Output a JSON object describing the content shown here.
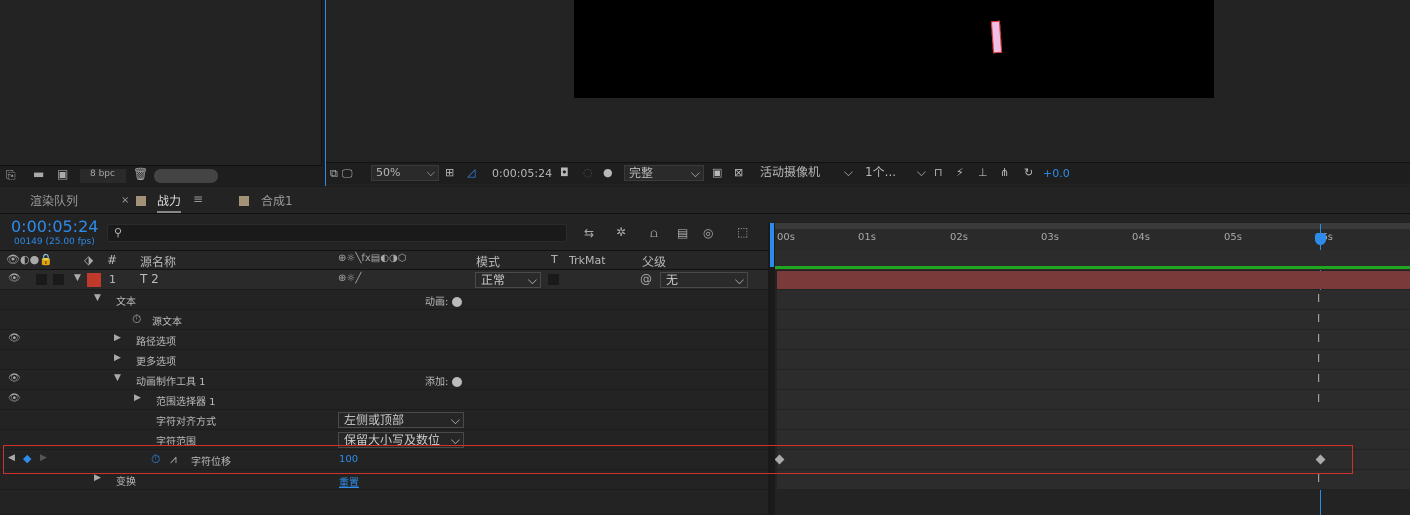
{
  "project": {
    "bpc": "8 bpc"
  },
  "comp_viewer": {
    "zoom": "50%",
    "timecode": "0:00:05:24",
    "resolution": "完整",
    "camera": "活动摄像机",
    "views": "1个...",
    "exposure": "+0.0"
  },
  "tabs": [
    {
      "label": "渲染队列"
    },
    {
      "label": "战力",
      "close": "×",
      "menu": "≡"
    },
    {
      "label": "合成1"
    }
  ],
  "timeline": {
    "timecode": "0:00:05:24",
    "frames_fps": "00149 (25.00 fps)",
    "search_placeholder": "",
    "columns": {
      "hash": "#",
      "source_name": "源名称",
      "mode": "模式",
      "t": "T",
      "trkmat": "TrkMat",
      "parent": "父级"
    },
    "ruler_ticks": [
      "00s",
      "01s",
      "02s",
      "03s",
      "04s",
      "05s",
      "06s"
    ],
    "layer": {
      "index": "1",
      "name": "T 2",
      "mode": "正常",
      "parent": "无"
    },
    "rows": [
      {
        "label": "文本",
        "right": "动画:"
      },
      {
        "label": "源文本"
      },
      {
        "label": "路径选项"
      },
      {
        "label": "更多选项"
      },
      {
        "label": "动画制作工具 1",
        "right": "添加:"
      },
      {
        "label": "范围选择器 1"
      },
      {
        "label": "字符对齐方式",
        "value": "左侧或顶部"
      },
      {
        "label": "字符范围",
        "value": "保留大小写及数位"
      },
      {
        "label": "字符位移",
        "value": "100"
      },
      {
        "label": "变换",
        "value": "重置"
      }
    ]
  },
  "colors": {
    "accent": "#2d8ceb",
    "layer_label": "#c0392b",
    "highlight": "#d0302a"
  }
}
